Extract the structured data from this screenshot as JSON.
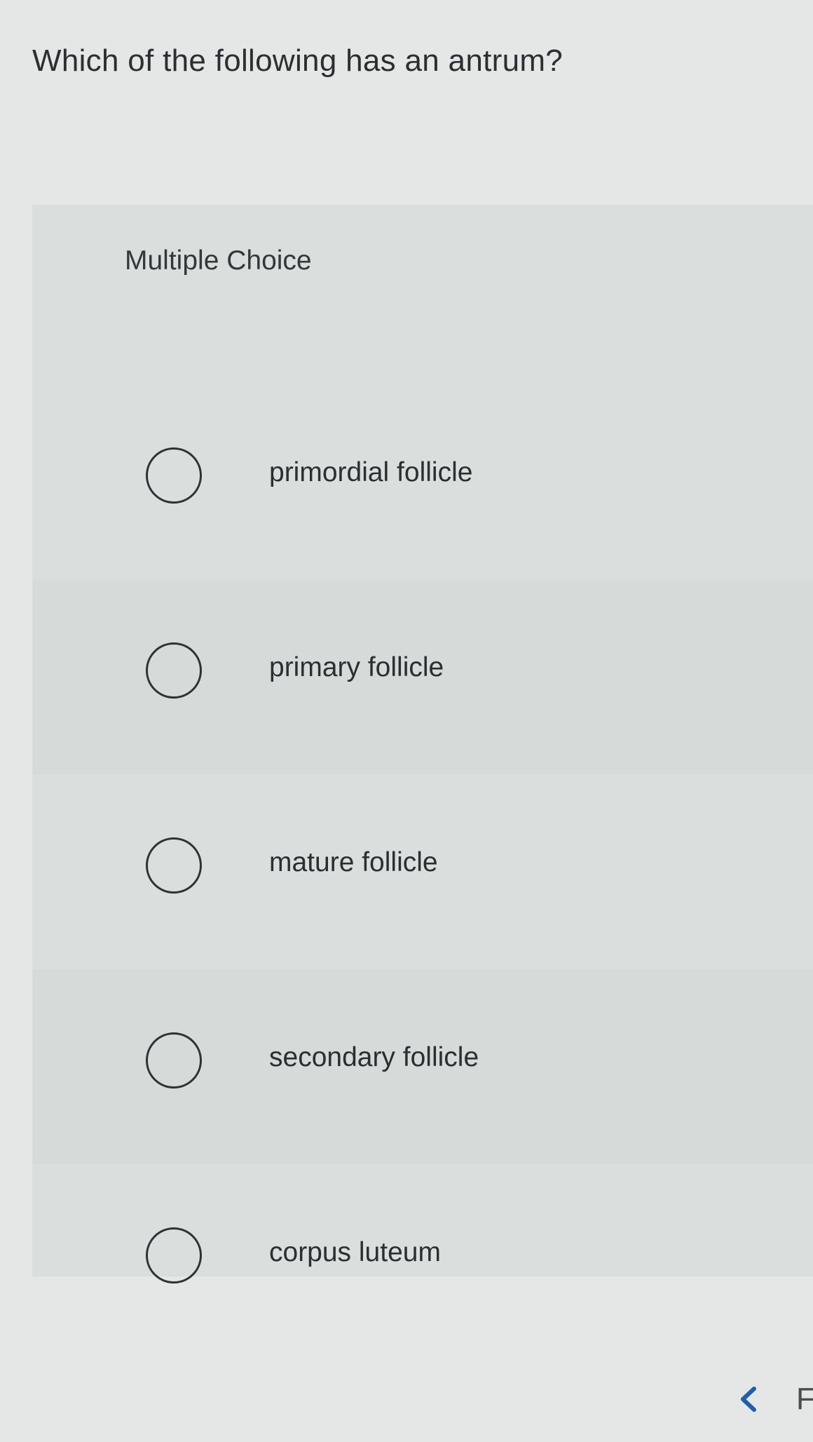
{
  "question": {
    "text": "Which of the following has an antrum?"
  },
  "choice_panel": {
    "header": "Multiple Choice",
    "options": [
      {
        "label": "primordial follicle",
        "selected": false
      },
      {
        "label": "primary follicle",
        "selected": false
      },
      {
        "label": "mature follicle",
        "selected": false
      },
      {
        "label": "secondary follicle",
        "selected": false
      },
      {
        "label": "corpus luteum",
        "selected": false
      }
    ]
  },
  "nav": {
    "prev_icon": "chevron-left-icon",
    "next_partial_text": "F",
    "accent_color": "#1f5fa8"
  }
}
